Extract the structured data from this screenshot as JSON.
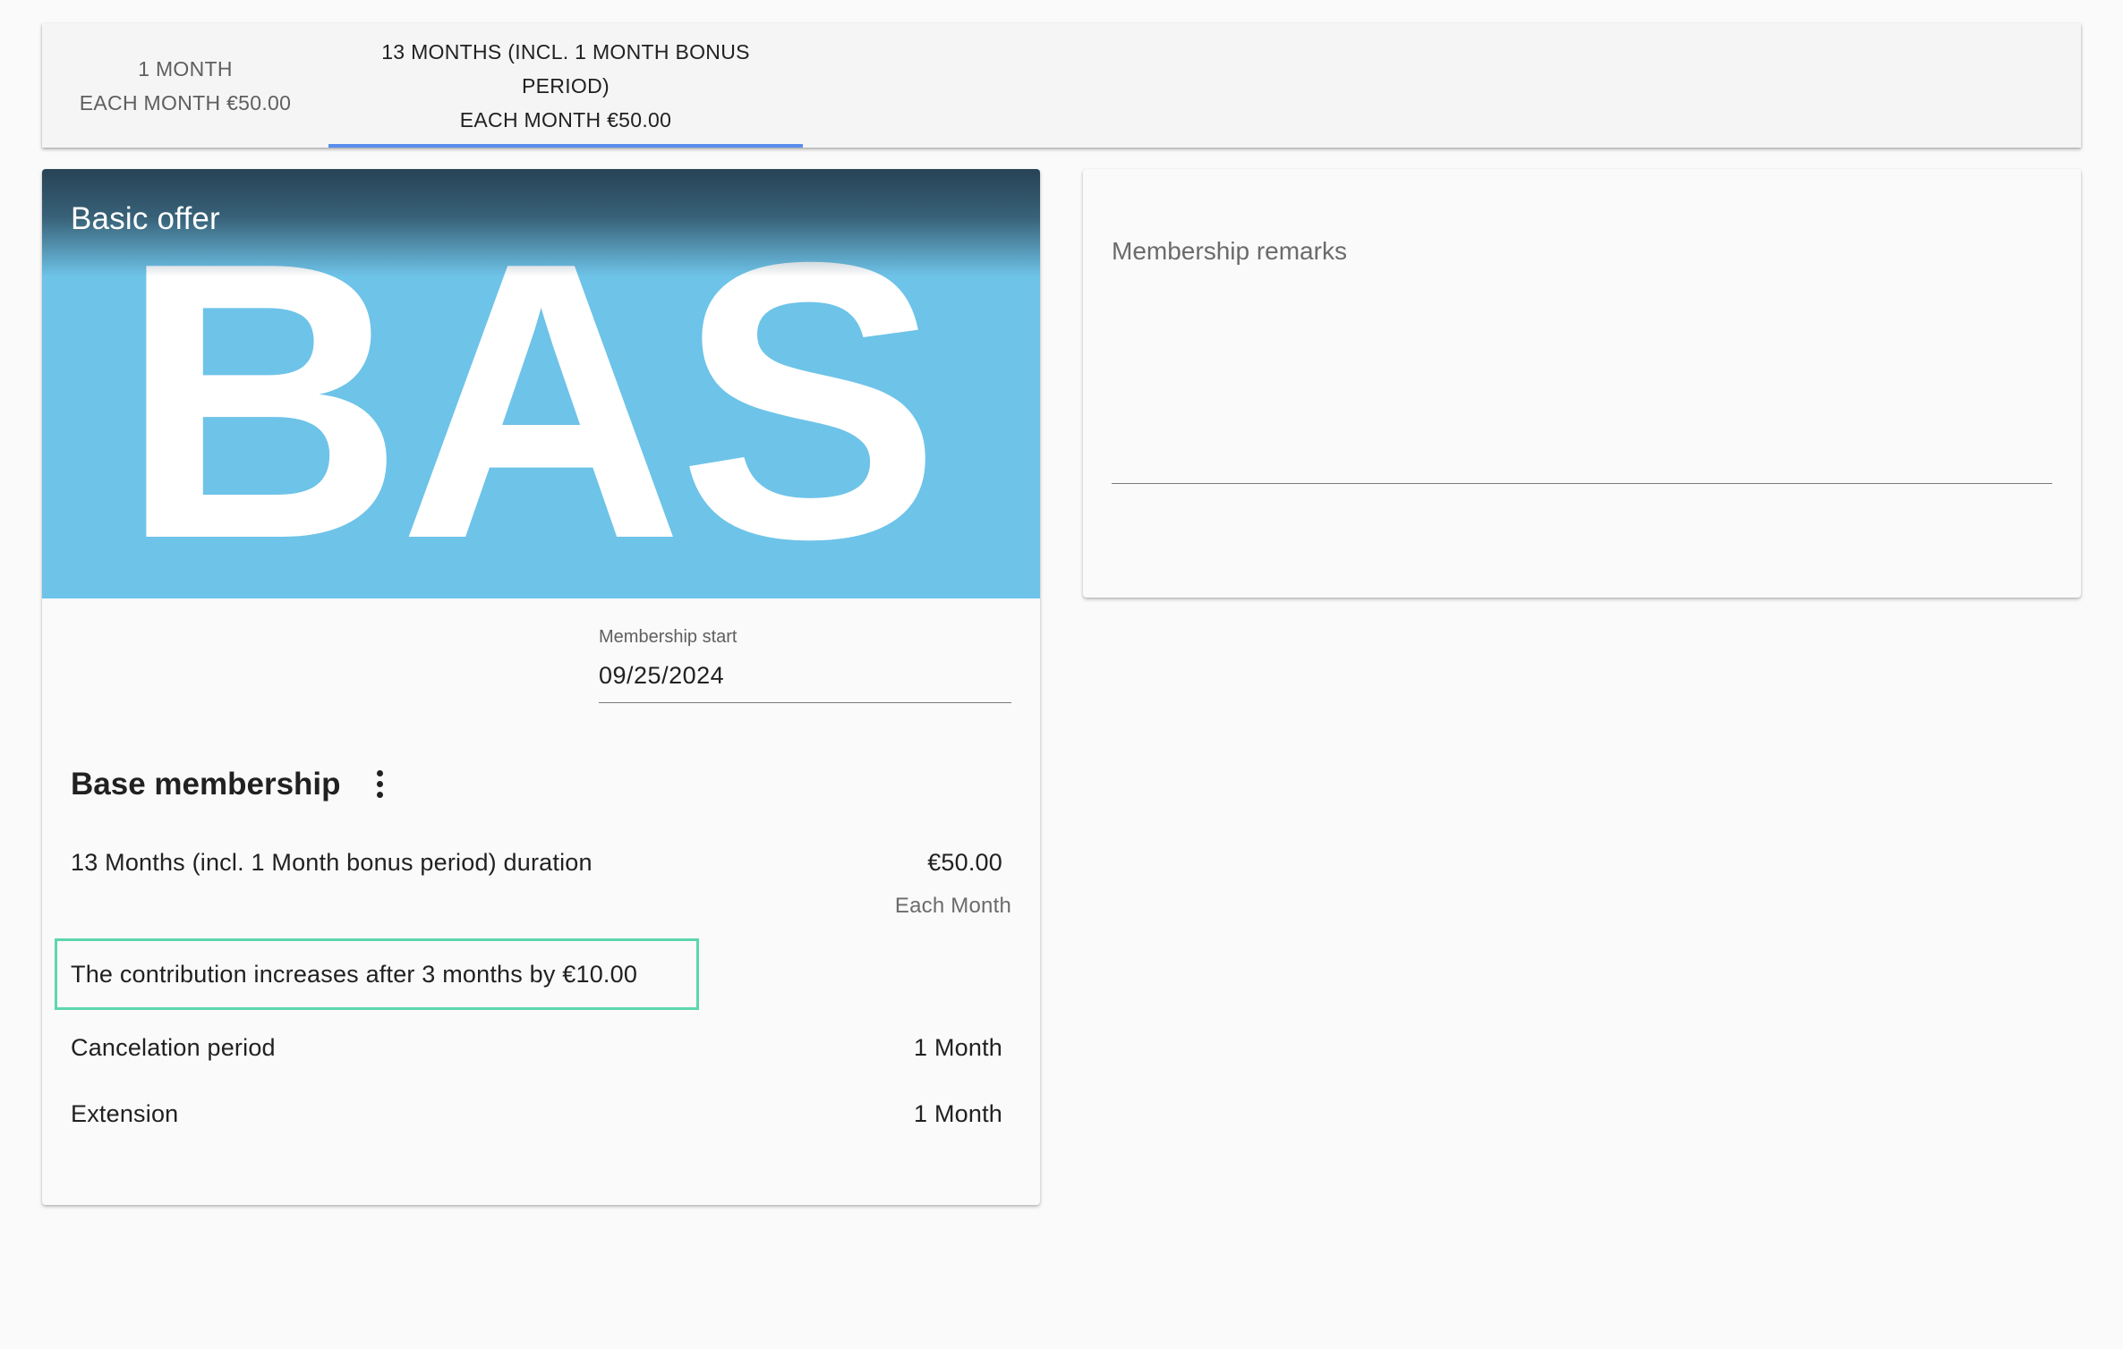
{
  "tabs": [
    {
      "line1": "1 Month",
      "line2": "Each Month €50.00",
      "selected": false
    },
    {
      "line1": "13 Months (incl. 1 Month bonus",
      "line1b": "period)",
      "line2": "Each Month €50.00",
      "selected": true
    }
  ],
  "offer": {
    "title": "Basic offer",
    "banner_text": "BAS",
    "banner_color": "#6ec3e8",
    "membership_start": {
      "label": "Membership start",
      "value": "09/25/2024"
    },
    "base_membership": {
      "title": "Base membership",
      "menu_icon": "more-vertical-icon",
      "duration_label": "13 Months (incl. 1 Month bonus period) duration",
      "price": "€50.00",
      "price_period": "Each Month",
      "increase_note": "The contribution increases after 3 months by €10.00",
      "cancelation_label": "Cancelation period",
      "cancelation_value": "1 Month",
      "extension_label": "Extension",
      "extension_value": "1 Month"
    }
  },
  "remarks": {
    "placeholder": "Membership remarks"
  },
  "colors": {
    "tab_indicator": "#5b8def",
    "highlight_border": "#5dd6ae"
  }
}
